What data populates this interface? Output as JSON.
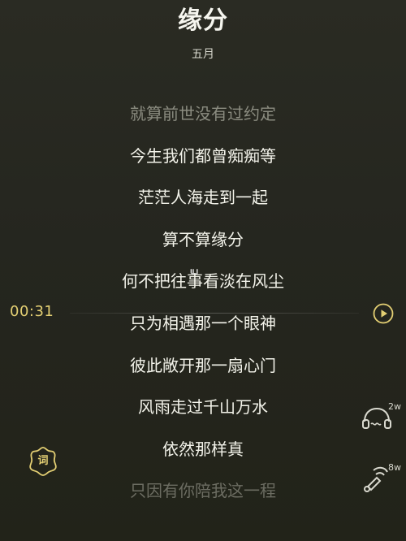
{
  "song": {
    "title": "缘分",
    "artist": "五月"
  },
  "lyrics": [
    "就算前世没有过约定",
    "今生我们都曾痴痴等",
    "茫茫人海走到一起",
    "算不算缘分",
    "何不把往事看淡在风尘",
    "只为相遇那一个眼神",
    "彼此敞开那一扇心门",
    "风雨走过千山万水",
    "依然那样真",
    "只因有你陪我这一程"
  ],
  "watermark": "ய",
  "player": {
    "current_time": "00:31"
  },
  "buttons": {
    "lyric_label": "词",
    "headphones_label": "2w",
    "speaker_label": "8w"
  },
  "colors": {
    "background": "#25261f",
    "accent": "#e3cf73",
    "text": "#f3f3ea"
  }
}
